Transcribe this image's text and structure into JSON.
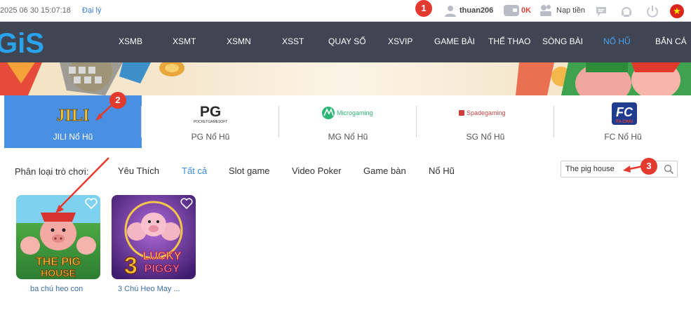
{
  "topbar": {
    "datetime": "2025 06 30 15:07:18",
    "agent_link": "Đại lý",
    "username": "thuan206",
    "balance": "0K",
    "deposit_label": "Nạp tiền",
    "icons": [
      "user-icon",
      "wallet-icon",
      "deposit-icon",
      "chat-icon",
      "support-icon",
      "power-icon",
      "vietnam-flag-icon"
    ]
  },
  "nav": {
    "logo_text": "GiS",
    "items": [
      {
        "label": "XSMB"
      },
      {
        "label": "XSMT"
      },
      {
        "label": "XSMN"
      },
      {
        "label": "XSST"
      },
      {
        "label": "QUAY SỐ"
      },
      {
        "label": "XSVIP"
      },
      {
        "label": "GAME BÀI"
      },
      {
        "label": "THỂ THAO"
      },
      {
        "label": "SÒNG BÀI"
      },
      {
        "label": "NỔ HŨ"
      },
      {
        "label": "BẮN CÁ"
      }
    ],
    "active": "NỔ HŨ"
  },
  "providers": {
    "items": [
      {
        "label": "JILI Nổ Hũ",
        "logo": "JILI",
        "active": true
      },
      {
        "label": "PG Nổ Hũ",
        "logo": "PG",
        "logo_sub": "POCKETGAMESOFT",
        "active": false
      },
      {
        "label": "MG Nổ Hũ",
        "logo": "Microgaming",
        "active": false
      },
      {
        "label": "SG Nổ Hũ",
        "logo": "Spadegaming",
        "active": false
      },
      {
        "label": "FC Nổ Hũ",
        "logo": "FC",
        "logo_sub": "FA CHAI",
        "active": false
      }
    ]
  },
  "filters": {
    "label": "Phân loại trò chơi:",
    "items": [
      {
        "label": "Yêu Thích",
        "active": false
      },
      {
        "label": "Tất cả",
        "active": true
      },
      {
        "label": "Slot game",
        "active": false
      },
      {
        "label": "Video Poker",
        "active": false
      },
      {
        "label": "Game bàn",
        "active": false
      },
      {
        "label": "Nổ Hũ",
        "active": false
      }
    ]
  },
  "search": {
    "value": "The pig house"
  },
  "games": [
    {
      "name": "ba chú heo con",
      "art_title_line1": "THE PIG",
      "art_title_line2": "HOUSE"
    },
    {
      "name": "3 Chú Heo May ...",
      "art_title_line1": "LUCKY",
      "art_title_line2": "PIGGY",
      "art_number": "3"
    }
  ],
  "annotations": [
    {
      "number": "1"
    },
    {
      "number": "2"
    },
    {
      "number": "3"
    }
  ],
  "colors": {
    "nav_bg": "#3f4552",
    "active_provider": "#4a90e2",
    "active_link": "#3a8de0",
    "annotation_red": "#e33a2f"
  }
}
